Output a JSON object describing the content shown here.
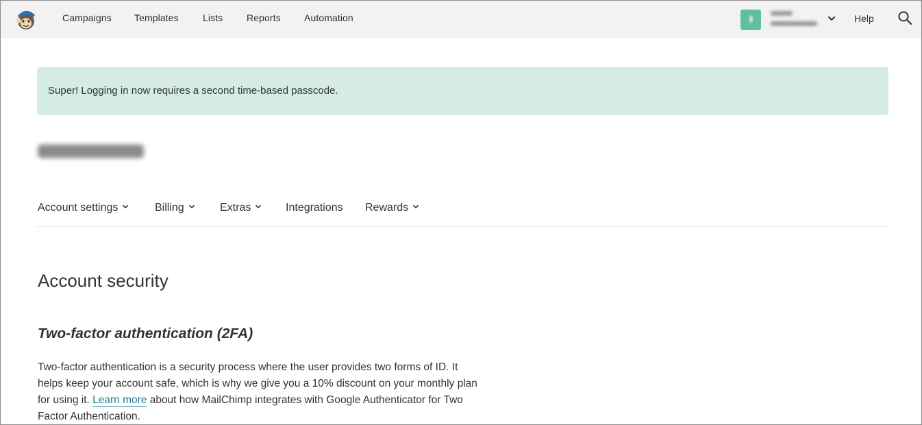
{
  "header": {
    "nav": [
      "Campaigns",
      "Templates",
      "Lists",
      "Reports",
      "Automation"
    ],
    "help_label": "Help",
    "colors": {
      "bar_bg": "#f2f2f2",
      "avatar": "#5fc0a0"
    }
  },
  "alert": {
    "text": "Super! Logging in now requires a second time-based passcode.",
    "bg_color": "#d4ece4"
  },
  "subnav": {
    "items": [
      {
        "label": "Account settings",
        "dropdown": true
      },
      {
        "label": "Billing",
        "dropdown": true
      },
      {
        "label": "Extras",
        "dropdown": true
      },
      {
        "label": "Integrations",
        "dropdown": false
      },
      {
        "label": "Rewards",
        "dropdown": true
      }
    ]
  },
  "page": {
    "title": "Account security",
    "section_title": "Two-factor authentication (2FA)",
    "para_before": "Two-factor authentication is a security process where the user provides two forms of ID. It helps keep your account safe, which is why we give you a 10% discount on your monthly plan for using it. ",
    "link_text": "Learn more",
    "para_after": " about how MailChimp integrates with Google Authenticator for Two Factor Authentication.",
    "link_color": "#1f8096"
  },
  "icons": {
    "logo": "mailchimp-monkey-icon",
    "search": "search-icon",
    "chevron": "chevron-down-icon"
  }
}
